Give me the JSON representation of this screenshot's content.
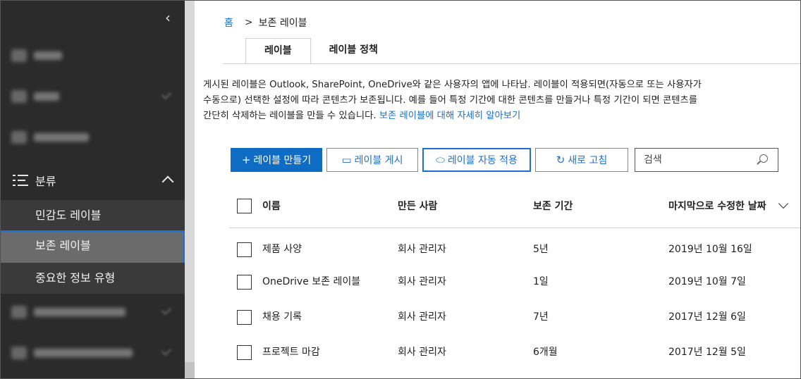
{
  "sidebar": {
    "section_label": "분류",
    "sub_items": [
      "민감도 레이블",
      "보존 레이블",
      "중요한 정보 유형"
    ]
  },
  "breadcrumb": {
    "home": "홈",
    "separator": ">",
    "current": "보존 레이블"
  },
  "tabs": [
    "레이블",
    "레이블 정책"
  ],
  "description": {
    "line1": "게시된 레이블은 Outlook, SharePoint, OneDrive와 같은 사용자의 앱에 나타남. 레이블이 적용되면(자동으로 또는 사용자가",
    "line2": "수동으로) 선택한 설정에 따라 콘텐츠가 보존됩니다. 예를 들어 특정 기간에 대한 콘텐츠를 만들거나 특정 기간이 되면 콘텐츠를",
    "line3": "간단히 삭제하는 레이블을 만들 수 있습니다.",
    "link": "보존 레이블에 대해 자세히 알아보기"
  },
  "toolbar": {
    "create": "레이블 만들기",
    "publish": "레이블 게시",
    "auto_apply": "레이블 자동 적용",
    "refresh": "새로 고침",
    "search_placeholder": "검색"
  },
  "table": {
    "columns": [
      "이름",
      "만든 사람",
      "보존 기간",
      "마지막으로 수정한 날짜"
    ],
    "rows": [
      {
        "name": "제품 사양",
        "created_by": "회사 관리자",
        "retention": "5년",
        "modified": "2019년 10월 16일"
      },
      {
        "name": "OneDrive 보존 레이블",
        "created_by": "회사 관리자",
        "retention": "1일",
        "modified": "2019년 10월 7일"
      },
      {
        "name": "채용 기록",
        "created_by": "회사 관리자",
        "retention": "7년",
        "modified": "2017년 12월 6일"
      },
      {
        "name": "프로젝트 마감",
        "created_by": "회사 관리자",
        "retention": "6개월",
        "modified": "2017년 12월 5일"
      }
    ]
  },
  "colors": {
    "accent": "#1f6fd1",
    "primary_button": "#0f6cc4",
    "sidebar_bg": "#2b2b2b",
    "active_item_bg": "#6b6b6b"
  }
}
